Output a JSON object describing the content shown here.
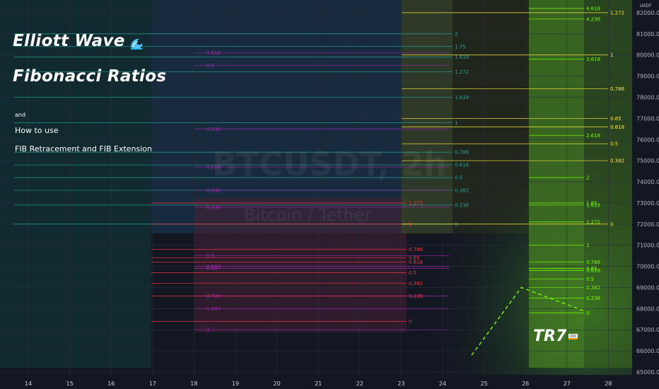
{
  "overlay": {
    "title_line1": "Elliott Wave",
    "title_line2": "Fibonacci Ratios",
    "and_text": "and",
    "howto_text": "How to use",
    "subtitle_text": "FIB Retracement and FIB Extension",
    "wave_icon": "water-wave-icon",
    "brand_text": "TR7",
    "brand_icon": "book-icon"
  },
  "watermark": {
    "symbol": "BTCUSDT, 2h",
    "name": "Bitcoin / Tether"
  },
  "axis": {
    "currency": "USDT",
    "price_labels": [
      "82000.00",
      "81000.00",
      "80000.00",
      "79000.00",
      "78000.00",
      "77000.00",
      "76000.00",
      "75000.00",
      "74000.00",
      "73000.00",
      "72000.00",
      "71000.00",
      "70000.00",
      "69000.00",
      "68000.00",
      "67000.00",
      "66000.00",
      "65000.00"
    ],
    "time_labels": [
      "14",
      "15",
      "16",
      "17",
      "18",
      "19",
      "20",
      "21",
      "22",
      "23",
      "24",
      "25",
      "26",
      "27",
      "28"
    ]
  },
  "chart_data": {
    "type": "line",
    "x": [
      "14",
      "15",
      "16",
      "17",
      "18",
      "19",
      "20",
      "21",
      "22",
      "23",
      "24",
      "25",
      "26",
      "27",
      "28"
    ],
    "ylim": [
      64800,
      82600
    ],
    "price_path": [
      {
        "x": "24.7",
        "y": 65800
      },
      {
        "x": "25.9",
        "y": 69000
      },
      {
        "x": "27.4",
        "y": 67900
      }
    ],
    "fib_sets": [
      {
        "name": "teal",
        "color": "#26a69a",
        "levels": [
          {
            "label": "2",
            "price": 81000
          },
          {
            "label": "1.75",
            "price": 80400
          },
          {
            "label": "1.618",
            "price": 79900
          },
          {
            "label": "1.272",
            "price": 79200
          },
          {
            "label": "1.618",
            "price": 78000
          },
          {
            "label": "1",
            "price": 76800
          },
          {
            "label": "0.786",
            "price": 75400
          },
          {
            "label": "0.618",
            "price": 74800
          },
          {
            "label": "0.5",
            "price": 74200
          },
          {
            "label": "0.382",
            "price": 73600
          },
          {
            "label": "0.236",
            "price": 72900
          },
          {
            "label": "0",
            "price": 72000
          }
        ]
      },
      {
        "name": "purple",
        "color": "#9c27b0",
        "levels": [
          {
            "label": "1.618",
            "price": 80100
          },
          {
            "label": "0.5",
            "price": 79500
          },
          {
            "label": "0.236",
            "price": 76500
          },
          {
            "label": "0.618",
            "price": 74700
          },
          {
            "label": "0.382",
            "price": 73600
          },
          {
            "label": "0.236",
            "price": 72800
          },
          {
            "label": "0.5",
            "price": 70500
          },
          {
            "label": "0.618",
            "price": 70000
          },
          {
            "label": "0.65",
            "price": 69900
          },
          {
            "label": "0.786",
            "price": 68600
          },
          {
            "label": "0.887",
            "price": 68000
          },
          {
            "label": "1",
            "price": 67000
          }
        ]
      },
      {
        "name": "red",
        "color": "#f23645",
        "levels": [
          {
            "label": "1.272",
            "price": 73000
          },
          {
            "label": "1",
            "price": 72000
          },
          {
            "label": "0.786",
            "price": 70800
          },
          {
            "label": "0.65",
            "price": 70400
          },
          {
            "label": "0.618",
            "price": 70200
          },
          {
            "label": "0.5",
            "price": 69700
          },
          {
            "label": "0.382",
            "price": 69200
          },
          {
            "label": "0.236",
            "price": 68600
          },
          {
            "label": "0",
            "price": 67400
          }
        ]
      },
      {
        "name": "yellow",
        "color": "#ffeb3b",
        "levels": [
          {
            "label": "1.272",
            "price": 82000
          },
          {
            "label": "1",
            "price": 80000
          },
          {
            "label": "0.786",
            "price": 78400
          },
          {
            "label": "0.65",
            "price": 77000
          },
          {
            "label": "0.618",
            "price": 76600
          },
          {
            "label": "0.5",
            "price": 75800
          },
          {
            "label": "0.382",
            "price": 75000
          },
          {
            "label": "0",
            "price": 72000
          }
        ]
      },
      {
        "name": "green",
        "color": "#76ff03",
        "levels": [
          {
            "label": "4.618",
            "price": 82200
          },
          {
            "label": "4.236",
            "price": 81700
          },
          {
            "label": "3.618",
            "price": 79800
          },
          {
            "label": "2.618",
            "price": 76200
          },
          {
            "label": "2",
            "price": 74200
          },
          {
            "label": "1.65",
            "price": 73000
          },
          {
            "label": "1.618",
            "price": 72900
          },
          {
            "label": "1.272",
            "price": 72100
          },
          {
            "label": "1",
            "price": 71000
          },
          {
            "label": "0.786",
            "price": 70200
          },
          {
            "label": "0.65",
            "price": 69900
          },
          {
            "label": "0.618",
            "price": 69800
          },
          {
            "label": "0.5",
            "price": 69400
          },
          {
            "label": "0.382",
            "price": 69000
          },
          {
            "label": "0.236",
            "price": 68500
          },
          {
            "label": "0",
            "price": 67800
          }
        ]
      }
    ]
  }
}
